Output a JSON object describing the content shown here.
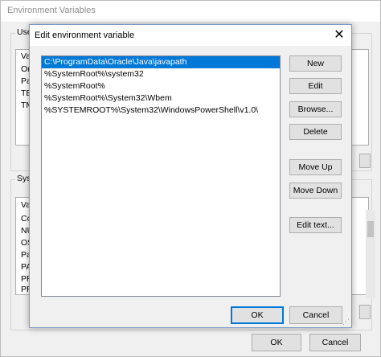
{
  "background_window": {
    "title": "Environment Variables",
    "user_group_label": "User",
    "user_rows": [
      "Va",
      "Or",
      "Pa",
      "TE",
      "TM"
    ],
    "system_group_label": "Syste",
    "system_rows": [
      "Va",
      "Co",
      "NU",
      "OS",
      "Pa",
      "PA",
      "PR",
      "PR"
    ],
    "ok_label": "OK",
    "cancel_label": "Cancel"
  },
  "dialog": {
    "title": "Edit environment variable",
    "close_glyph": "✕",
    "paths": [
      "C:\\ProgramData\\Oracle\\Java\\javapath",
      "%SystemRoot%\\system32",
      "%SystemRoot%",
      "%SystemRoot%\\System32\\Wbem",
      "%SYSTEMROOT%\\System32\\WindowsPowerShell\\v1.0\\"
    ],
    "selected_index": 0,
    "buttons": {
      "new": "New",
      "edit": "Edit",
      "browse": "Browse...",
      "delete": "Delete",
      "move_up": "Move Up",
      "move_down": "Move Down",
      "edit_text": "Edit text..."
    },
    "ok_label": "OK",
    "cancel_label": "Cancel"
  },
  "colors": {
    "selection": "#0078d7",
    "dialog_bg": "#f0f0f0",
    "button_bg": "#e1e1e1"
  }
}
